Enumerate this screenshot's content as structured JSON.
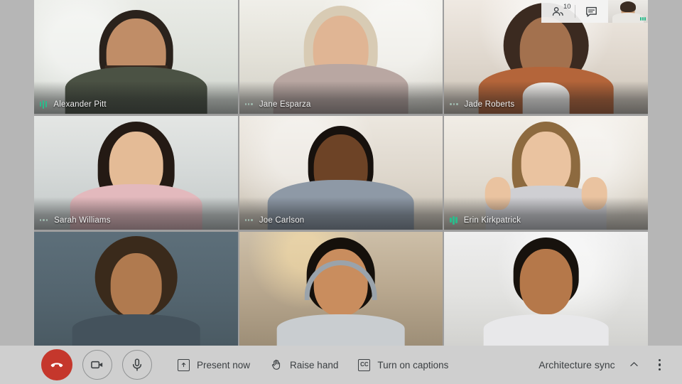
{
  "app": {
    "title": "Video meeting grid view"
  },
  "top_controls": {
    "people_icon": "people-icon",
    "participant_count": "10",
    "chat_icon": "chat-icon",
    "self_view_label": "self-view"
  },
  "grid": {
    "tiles": [
      {
        "name": "Alexander Pitt",
        "audio_state": "active",
        "scene": "room-a",
        "has_label": true
      },
      {
        "name": "Jane Esparza",
        "audio_state": "inactive",
        "scene": "room-b",
        "has_label": true
      },
      {
        "name": "Jade Roberts",
        "audio_state": "inactive",
        "scene": "room-c",
        "has_label": true
      },
      {
        "name": "Sarah Williams",
        "audio_state": "inactive",
        "scene": "room-d",
        "has_label": true
      },
      {
        "name": "Joe Carlson",
        "audio_state": "inactive",
        "scene": "room-e",
        "has_label": true
      },
      {
        "name": "Erin Kirkpatrick",
        "audio_state": "active",
        "scene": "room-f",
        "has_label": true
      },
      {
        "name": "",
        "audio_state": "none",
        "scene": "room-g",
        "has_label": false
      },
      {
        "name": "",
        "audio_state": "none",
        "scene": "room-h",
        "has_label": false
      },
      {
        "name": "",
        "audio_state": "none",
        "scene": "room-i",
        "has_label": false
      }
    ]
  },
  "toolbar": {
    "hangup_label": "End call",
    "camera_label": "Turn off camera",
    "mic_label": "Mute microphone",
    "present_label": "Present now",
    "raise_hand_label": "Raise hand",
    "captions_label": "Turn on captions",
    "captions_icon_text": "CC",
    "meeting_title": "Architecture sync",
    "more_options_label": "More options"
  },
  "colors": {
    "background": "#b6b6b6",
    "toolbar_bg": "#cfcfcf",
    "hangup_red": "#c5372c",
    "audio_green": "#2bbb8c",
    "text_dark": "#3c4043",
    "name_text": "#f1f1f1"
  }
}
